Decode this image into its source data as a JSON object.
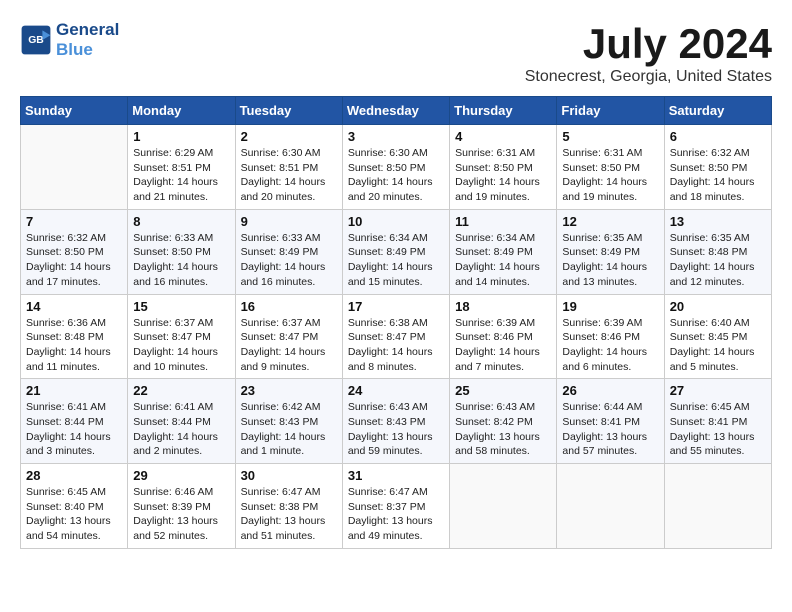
{
  "header": {
    "logo_line1": "General",
    "logo_line2": "Blue",
    "title": "July 2024",
    "subtitle": "Stonecrest, Georgia, United States"
  },
  "days_of_week": [
    "Sunday",
    "Monday",
    "Tuesday",
    "Wednesday",
    "Thursday",
    "Friday",
    "Saturday"
  ],
  "weeks": [
    [
      {
        "num": "",
        "info": ""
      },
      {
        "num": "1",
        "info": "Sunrise: 6:29 AM\nSunset: 8:51 PM\nDaylight: 14 hours\nand 21 minutes."
      },
      {
        "num": "2",
        "info": "Sunrise: 6:30 AM\nSunset: 8:51 PM\nDaylight: 14 hours\nand 20 minutes."
      },
      {
        "num": "3",
        "info": "Sunrise: 6:30 AM\nSunset: 8:50 PM\nDaylight: 14 hours\nand 20 minutes."
      },
      {
        "num": "4",
        "info": "Sunrise: 6:31 AM\nSunset: 8:50 PM\nDaylight: 14 hours\nand 19 minutes."
      },
      {
        "num": "5",
        "info": "Sunrise: 6:31 AM\nSunset: 8:50 PM\nDaylight: 14 hours\nand 19 minutes."
      },
      {
        "num": "6",
        "info": "Sunrise: 6:32 AM\nSunset: 8:50 PM\nDaylight: 14 hours\nand 18 minutes."
      }
    ],
    [
      {
        "num": "7",
        "info": "Sunrise: 6:32 AM\nSunset: 8:50 PM\nDaylight: 14 hours\nand 17 minutes."
      },
      {
        "num": "8",
        "info": "Sunrise: 6:33 AM\nSunset: 8:50 PM\nDaylight: 14 hours\nand 16 minutes."
      },
      {
        "num": "9",
        "info": "Sunrise: 6:33 AM\nSunset: 8:49 PM\nDaylight: 14 hours\nand 16 minutes."
      },
      {
        "num": "10",
        "info": "Sunrise: 6:34 AM\nSunset: 8:49 PM\nDaylight: 14 hours\nand 15 minutes."
      },
      {
        "num": "11",
        "info": "Sunrise: 6:34 AM\nSunset: 8:49 PM\nDaylight: 14 hours\nand 14 minutes."
      },
      {
        "num": "12",
        "info": "Sunrise: 6:35 AM\nSunset: 8:49 PM\nDaylight: 14 hours\nand 13 minutes."
      },
      {
        "num": "13",
        "info": "Sunrise: 6:35 AM\nSunset: 8:48 PM\nDaylight: 14 hours\nand 12 minutes."
      }
    ],
    [
      {
        "num": "14",
        "info": "Sunrise: 6:36 AM\nSunset: 8:48 PM\nDaylight: 14 hours\nand 11 minutes."
      },
      {
        "num": "15",
        "info": "Sunrise: 6:37 AM\nSunset: 8:47 PM\nDaylight: 14 hours\nand 10 minutes."
      },
      {
        "num": "16",
        "info": "Sunrise: 6:37 AM\nSunset: 8:47 PM\nDaylight: 14 hours\nand 9 minutes."
      },
      {
        "num": "17",
        "info": "Sunrise: 6:38 AM\nSunset: 8:47 PM\nDaylight: 14 hours\nand 8 minutes."
      },
      {
        "num": "18",
        "info": "Sunrise: 6:39 AM\nSunset: 8:46 PM\nDaylight: 14 hours\nand 7 minutes."
      },
      {
        "num": "19",
        "info": "Sunrise: 6:39 AM\nSunset: 8:46 PM\nDaylight: 14 hours\nand 6 minutes."
      },
      {
        "num": "20",
        "info": "Sunrise: 6:40 AM\nSunset: 8:45 PM\nDaylight: 14 hours\nand 5 minutes."
      }
    ],
    [
      {
        "num": "21",
        "info": "Sunrise: 6:41 AM\nSunset: 8:44 PM\nDaylight: 14 hours\nand 3 minutes."
      },
      {
        "num": "22",
        "info": "Sunrise: 6:41 AM\nSunset: 8:44 PM\nDaylight: 14 hours\nand 2 minutes."
      },
      {
        "num": "23",
        "info": "Sunrise: 6:42 AM\nSunset: 8:43 PM\nDaylight: 14 hours\nand 1 minute."
      },
      {
        "num": "24",
        "info": "Sunrise: 6:43 AM\nSunset: 8:43 PM\nDaylight: 13 hours\nand 59 minutes."
      },
      {
        "num": "25",
        "info": "Sunrise: 6:43 AM\nSunset: 8:42 PM\nDaylight: 13 hours\nand 58 minutes."
      },
      {
        "num": "26",
        "info": "Sunrise: 6:44 AM\nSunset: 8:41 PM\nDaylight: 13 hours\nand 57 minutes."
      },
      {
        "num": "27",
        "info": "Sunrise: 6:45 AM\nSunset: 8:41 PM\nDaylight: 13 hours\nand 55 minutes."
      }
    ],
    [
      {
        "num": "28",
        "info": "Sunrise: 6:45 AM\nSunset: 8:40 PM\nDaylight: 13 hours\nand 54 minutes."
      },
      {
        "num": "29",
        "info": "Sunrise: 6:46 AM\nSunset: 8:39 PM\nDaylight: 13 hours\nand 52 minutes."
      },
      {
        "num": "30",
        "info": "Sunrise: 6:47 AM\nSunset: 8:38 PM\nDaylight: 13 hours\nand 51 minutes."
      },
      {
        "num": "31",
        "info": "Sunrise: 6:47 AM\nSunset: 8:37 PM\nDaylight: 13 hours\nand 49 minutes."
      },
      {
        "num": "",
        "info": ""
      },
      {
        "num": "",
        "info": ""
      },
      {
        "num": "",
        "info": ""
      }
    ]
  ]
}
